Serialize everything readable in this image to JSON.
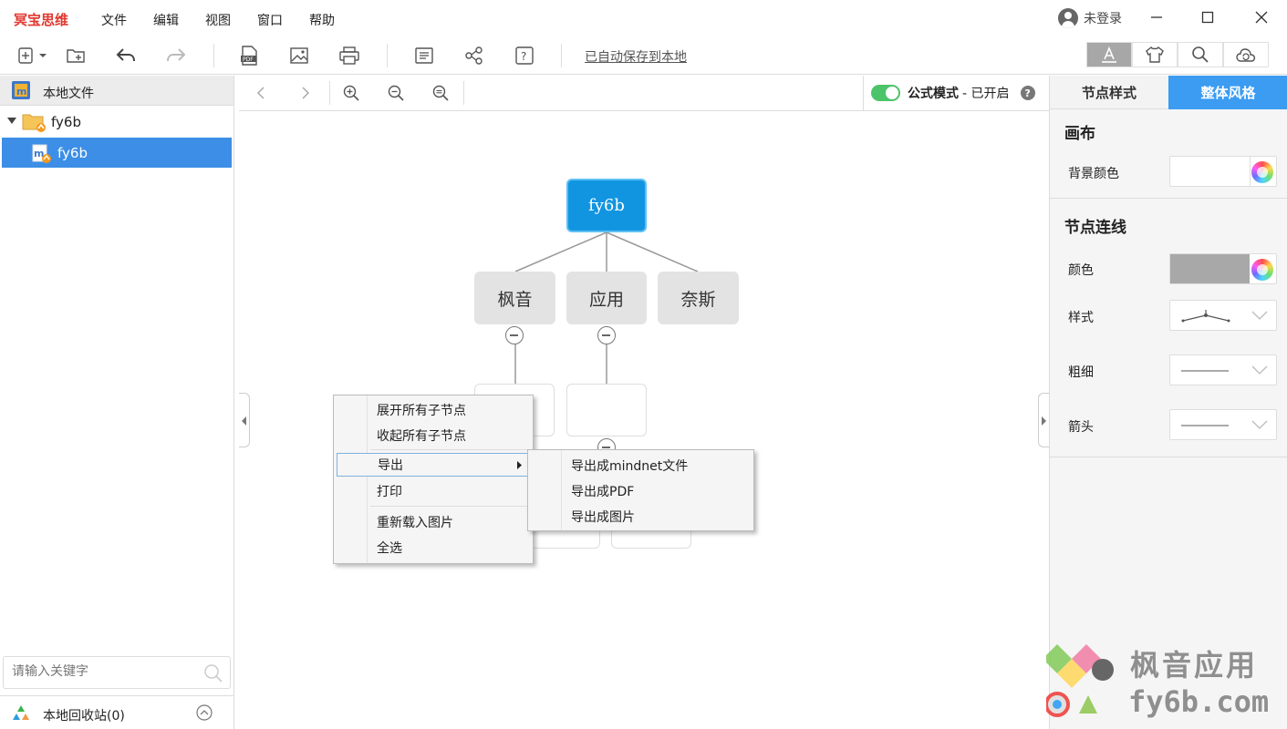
{
  "app": {
    "brand": "冥宝思维"
  },
  "menu": {
    "items": [
      "文件",
      "编辑",
      "视图",
      "窗口",
      "帮助"
    ]
  },
  "user": {
    "status": "未登录"
  },
  "toolbar": {
    "autosave": "已自动保存到本地"
  },
  "left_panel": {
    "header": "本地文件",
    "tree": [
      {
        "label": "fy6b",
        "type": "folder"
      },
      {
        "label": "fy6b",
        "type": "file",
        "selected": true
      }
    ],
    "search_placeholder": "请输入关键字",
    "recycle_label": "本地回收站(0)"
  },
  "canvas": {
    "formula_mode_label": "公式模式",
    "formula_mode_state": "- 已开启",
    "help": "?",
    "nodes": {
      "root": "fy6b",
      "children": [
        "枫音",
        "应用",
        "奈斯"
      ]
    }
  },
  "context_menu": {
    "items": [
      "展开所有子节点",
      "收起所有子节点",
      "导出",
      "打印",
      "重新载入图片",
      "全选"
    ],
    "submenu": [
      "导出成mindnet文件",
      "导出成PDF",
      "导出成图片"
    ]
  },
  "right_panel": {
    "tabs": [
      "节点样式",
      "整体风格"
    ],
    "active_tab": "整体风格",
    "sections": {
      "canvas_title": "画布",
      "bg_color_label": "背景颜色",
      "line_title": "节点连线",
      "color_label": "颜色",
      "style_label": "样式",
      "thickness_label": "粗细",
      "arrow_label": "箭头"
    },
    "line_color": "#a8a8a8"
  },
  "watermark": {
    "line1": "枫音应用",
    "line2": "fy6b.com"
  },
  "colors": {
    "accent": "#3b9cf2",
    "selection": "#3c8ee6",
    "brand": "#e0382f",
    "root_node": "#1295e0",
    "toggle_on": "#4cc46a"
  }
}
